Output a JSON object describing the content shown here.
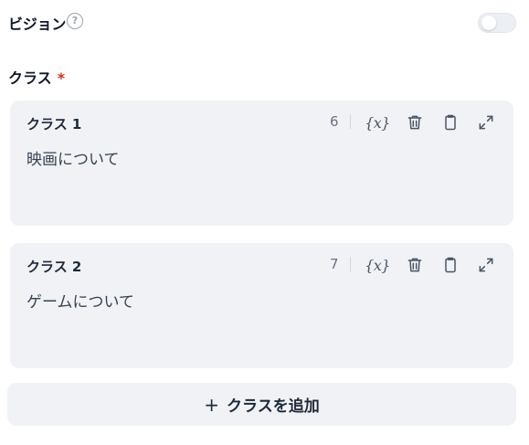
{
  "vision": {
    "label": "ビジョン",
    "help_glyph": "?",
    "enabled": false
  },
  "classes": {
    "label": "クラス",
    "required_mark": "*",
    "items": [
      {
        "title": "クラス 1",
        "count": "6",
        "text": "映画について"
      },
      {
        "title": "クラス 2",
        "count": "7",
        "text": "ゲームについて"
      }
    ],
    "variable_icon_text": "{x}",
    "add_button_label": "クラスを追加",
    "add_button_plus": "+"
  },
  "icons": {
    "help": "help-circle-icon",
    "variable": "variable-icon",
    "delete": "trash-icon",
    "copy": "clipboard-icon",
    "expand": "expand-icon"
  },
  "colors": {
    "card_background": "#f0f2f6",
    "required": "#d92d20",
    "icon": "#4b5563",
    "muted_text": "#6b7280"
  }
}
